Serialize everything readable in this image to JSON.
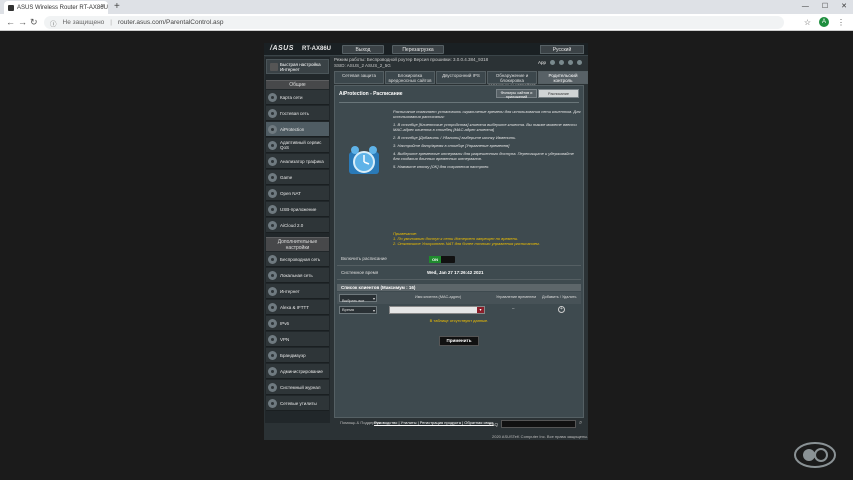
{
  "browser": {
    "tab_title": "ASUS Wireless Router RT-AX86U",
    "new_tab": "+",
    "security_label": "Не защищено",
    "url": "router.asus.com/ParentalControl.asp",
    "profile_initial": "A",
    "win_min": "—",
    "win_max": "☐",
    "win_close": "✕"
  },
  "router": {
    "brand": "/ASUS",
    "model": "RT-AX86U",
    "logout_label": "Выход",
    "reboot_label": "Перезагрузка",
    "language": "Русский",
    "info_line1": "Режим работы: Беспроводной роутер  Версия прошивки: 3.0.0.4.384_9318",
    "info_line2": "SSID: ASUS_2   ASUS_2_5G",
    "app_label": "App",
    "quick_setup": "Быстрая настройка Интернет",
    "section_general": "Общие",
    "section_advanced": "Дополнительные настройки",
    "general_items": [
      {
        "label": "Карта сети"
      },
      {
        "label": "Гостевая сеть"
      },
      {
        "label": "AiProtection"
      },
      {
        "label": "Адаптивный сервис QoS"
      },
      {
        "label": "Анализатор трафика"
      },
      {
        "label": "Game"
      },
      {
        "label": "Open NAT"
      },
      {
        "label": "USB-приложение"
      },
      {
        "label": "AiCloud 2.0"
      }
    ],
    "advanced_items": [
      {
        "label": "Беспроводная сеть"
      },
      {
        "label": "Локальная сеть"
      },
      {
        "label": "Интернет"
      },
      {
        "label": "Alexa & IFTTT"
      },
      {
        "label": "IPv6"
      },
      {
        "label": "VPN"
      },
      {
        "label": "Брандмауэр"
      },
      {
        "label": "Администрирование"
      },
      {
        "label": "Системный журнал"
      },
      {
        "label": "Сетевые утилиты"
      }
    ],
    "tabs": [
      {
        "label": "Сетевая защита"
      },
      {
        "label": "Блокировка вредоносных сайтов"
      },
      {
        "label": "Двусторонний IPS"
      },
      {
        "label": "Обнаружение и блокировка зараженных устройств"
      },
      {
        "label": "Родительский контроль"
      }
    ],
    "page_title": "AiProtection - Расписание",
    "subtabs": [
      {
        "label": "Фильтры сайтов и приложений"
      },
      {
        "label": "Расписание"
      }
    ],
    "desc_intro": "Расписание позволяет установить ограничение времени для использования сети клиентом. Для использования расписания:",
    "steps": [
      "1. В столбце [Клиентские устройства] клиента выберите клиента. Вы также можете ввести MAC-адрес клиента в столбец [MAC-адрес клиента]",
      "2. В столбце [Добавить / Удалить] выберите иконку Изменить.",
      "3. Настройте дату/время в столбце [Управление временем]",
      "4. Выберите временные интервалы для разрешенного доступа. Перетащите и удерживайте для создания длинных временных интервалов.",
      "5. Нажмите кнопку [OK] для сохранения настроек."
    ],
    "note_heading": "Примечание:",
    "notes": [
      "1. По умолчанию доступ к сети Интернет запрещен по времени.",
      "2. Отключите Ускоритель NAT для более точного управления расписанием."
    ],
    "enable_label": "Включить расписание",
    "enable_value": "ON",
    "systime_label": "Системное время",
    "systime_value": "Wed, Jan 27 17:26:42 2021",
    "list_header": "Список клиентов (Максимум : 16)",
    "col_select": "Выбрать все",
    "col_client": "Имя клиента (MAC-адрес)",
    "col_time": "Управление временем",
    "col_add": "Добавить / Удалить",
    "row_select": "Время",
    "row_time": "–",
    "empty_text": "В таблице отсутствуют данные.",
    "apply_label": "Применить",
    "help_label": "Помощь & Поддержка",
    "footer_links": "Руководство | Утилиты | Регистрация продукта | Обратная связь",
    "faq_label": "FAQ",
    "copyright": "2020 ASUSTeK Computer Inc. Все права защищены."
  },
  "colors": {
    "accent_green": "#1f8a2e",
    "note_yellow": "#f0c000",
    "dropdown_red": "#8b1e2a"
  }
}
